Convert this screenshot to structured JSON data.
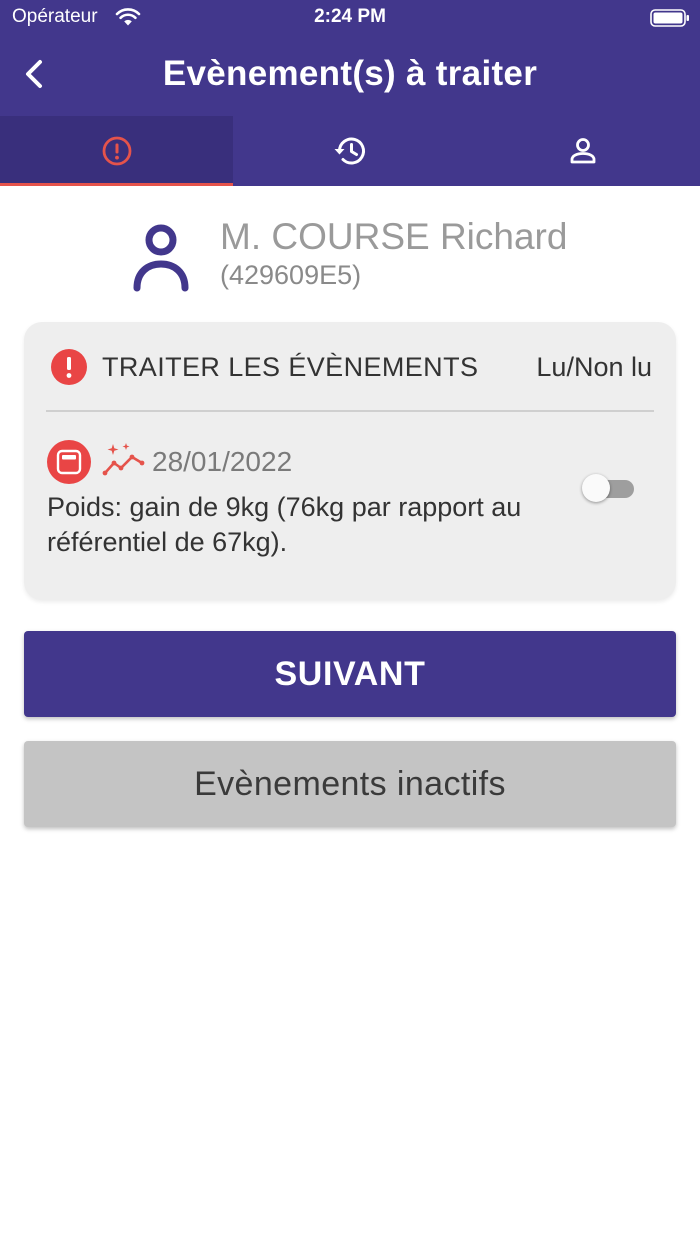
{
  "status_bar": {
    "carrier": "Opérateur",
    "time": "2:24 PM",
    "wifi_icon": "wifi-icon",
    "battery_icon": "battery-icon"
  },
  "nav": {
    "title": "Evènement(s) à traiter",
    "back_icon": "chevron-left-icon"
  },
  "tabs": [
    {
      "icon": "alert-circle-icon",
      "active": true
    },
    {
      "icon": "history-icon",
      "active": false
    },
    {
      "icon": "person-icon",
      "active": false
    }
  ],
  "patient": {
    "name": "M. COURSE Richard",
    "id": "(429609E5)"
  },
  "events_card": {
    "title": "TRAITER LES ÉVÈNEMENTS",
    "read_label": "Lu/Non lu",
    "events": [
      {
        "date": "28/01/2022",
        "description": "Poids: gain de 9kg (76kg par rapport au référentiel de 67kg).",
        "read": false
      }
    ]
  },
  "buttons": {
    "next": "SUIVANT",
    "inactive_events": "Evènements inactifs"
  },
  "colors": {
    "primary": "#42378c",
    "primary_dark": "#392f7c",
    "alert": "#e94545",
    "card_bg": "#eeeeee",
    "inactive_button": "#c4c4c4"
  }
}
